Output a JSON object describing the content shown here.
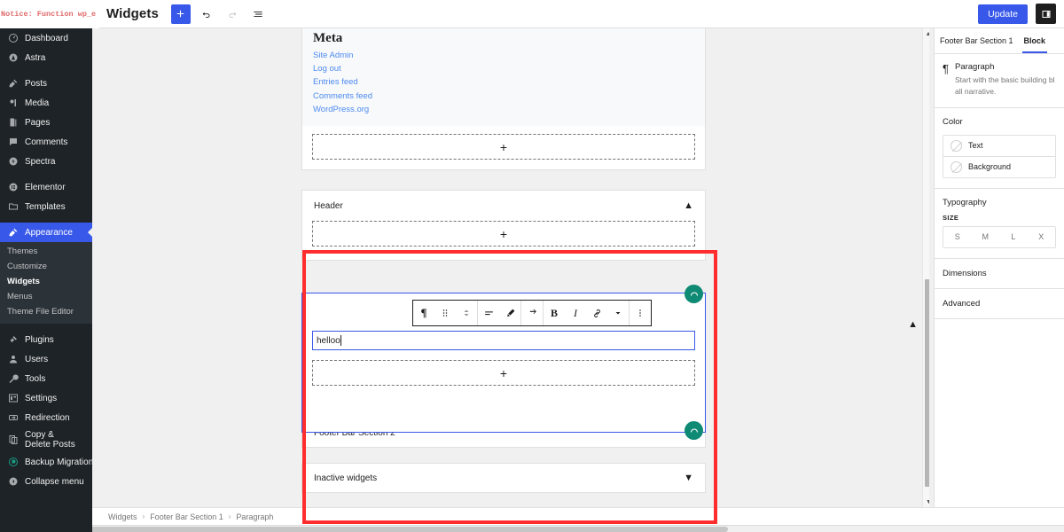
{
  "notice": {
    "text": "Notice: Function wp_e"
  },
  "topbar": {
    "title": "Widgets",
    "add_block_label": "+",
    "undo_label": "undo-icon",
    "redo_label": "redo-icon",
    "list_view_label": "list-view-icon",
    "update_label": "Update",
    "settings_toggle_label": "settings-panel-icon"
  },
  "adminmenu": {
    "items": [
      {
        "label": "Dashboard",
        "icon": "dashboard-icon"
      },
      {
        "label": "Astra",
        "icon": "astra-icon"
      },
      {
        "label": "Posts",
        "icon": "posts-icon"
      },
      {
        "label": "Media",
        "icon": "media-icon"
      },
      {
        "label": "Pages",
        "icon": "pages-icon"
      },
      {
        "label": "Comments",
        "icon": "comments-icon"
      },
      {
        "label": "Spectra",
        "icon": "spectra-icon"
      },
      {
        "label": "Elementor",
        "icon": "elementor-icon"
      },
      {
        "label": "Templates",
        "icon": "templates-icon"
      },
      {
        "label": "Appearance",
        "icon": "appearance-icon"
      },
      {
        "label": "Plugins",
        "icon": "plugins-icon"
      },
      {
        "label": "Users",
        "icon": "users-icon"
      },
      {
        "label": "Tools",
        "icon": "tools-icon"
      },
      {
        "label": "Settings",
        "icon": "settings-icon"
      },
      {
        "label": "Redirection",
        "icon": "redirection-icon"
      },
      {
        "label": "Copy & Delete Posts",
        "icon": "copy-delete-icon"
      },
      {
        "label": "Backup Migration",
        "icon": "backup-migration-icon"
      },
      {
        "label": "Collapse menu",
        "icon": "collapse-menu-icon"
      }
    ],
    "submenu": [
      {
        "label": "Themes"
      },
      {
        "label": "Customize"
      },
      {
        "label": "Widgets"
      },
      {
        "label": "Menus"
      },
      {
        "label": "Theme File Editor"
      }
    ]
  },
  "editor": {
    "meta_widget": {
      "title": "Meta",
      "links": [
        "Site Admin",
        "Log out",
        "Entries feed",
        "Comments feed",
        "WordPress.org"
      ]
    },
    "appender_label": "+",
    "header_area": {
      "label": "Header"
    },
    "footer_bar_1": {
      "label": "Footer Bar Section 1",
      "paragraph_value": "helloo"
    },
    "footer_bar_2": {
      "label": "Footer Bar Section 2"
    },
    "inactive_widgets": {
      "label": "Inactive widgets"
    },
    "block_toolbar": [
      {
        "name": "paragraph-type-icon",
        "glyph": "¶"
      },
      {
        "name": "drag-handle-icon",
        "glyph": "drag"
      },
      {
        "name": "move-up-down-icon",
        "glyph": "updown"
      },
      {
        "name": "align-text-icon",
        "glyph": "align"
      },
      {
        "name": "text-color-icon",
        "glyph": "pen"
      },
      {
        "name": "transform-icon",
        "glyph": "transform"
      },
      {
        "name": "bold-icon",
        "glyph": "B"
      },
      {
        "name": "italic-icon",
        "glyph": "I"
      },
      {
        "name": "link-icon",
        "glyph": "link"
      },
      {
        "name": "more-rich-text-icon",
        "glyph": "chevron"
      },
      {
        "name": "block-options-icon",
        "glyph": "kebab"
      }
    ]
  },
  "inspector": {
    "tabs": [
      {
        "label": "Footer Bar Section 1",
        "active": false
      },
      {
        "label": "Block",
        "active": true
      }
    ],
    "block_card": {
      "icon": "¶",
      "title": "Paragraph",
      "description_line1": "Start with the basic building bl",
      "description_line2": "all narrative."
    },
    "color": {
      "title": "Color",
      "rows": [
        {
          "label": "Text"
        },
        {
          "label": "Background"
        }
      ]
    },
    "typography": {
      "title": "Typography",
      "size_label": "SIZE",
      "sizes": [
        "S",
        "M",
        "L",
        "X"
      ]
    },
    "dimensions_label": "Dimensions",
    "advanced_label": "Advanced"
  },
  "breadcrumb": {
    "items": [
      "Widgets",
      "Footer Bar Section 1",
      "Paragraph"
    ],
    "separator": "›"
  },
  "colors": {
    "accent": "#3858e9",
    "admin_bg": "#1d2327",
    "highlight_outline": "#ff2d2d",
    "badge_green": "#0f8a74",
    "link_blue": "#4d8bf0"
  }
}
